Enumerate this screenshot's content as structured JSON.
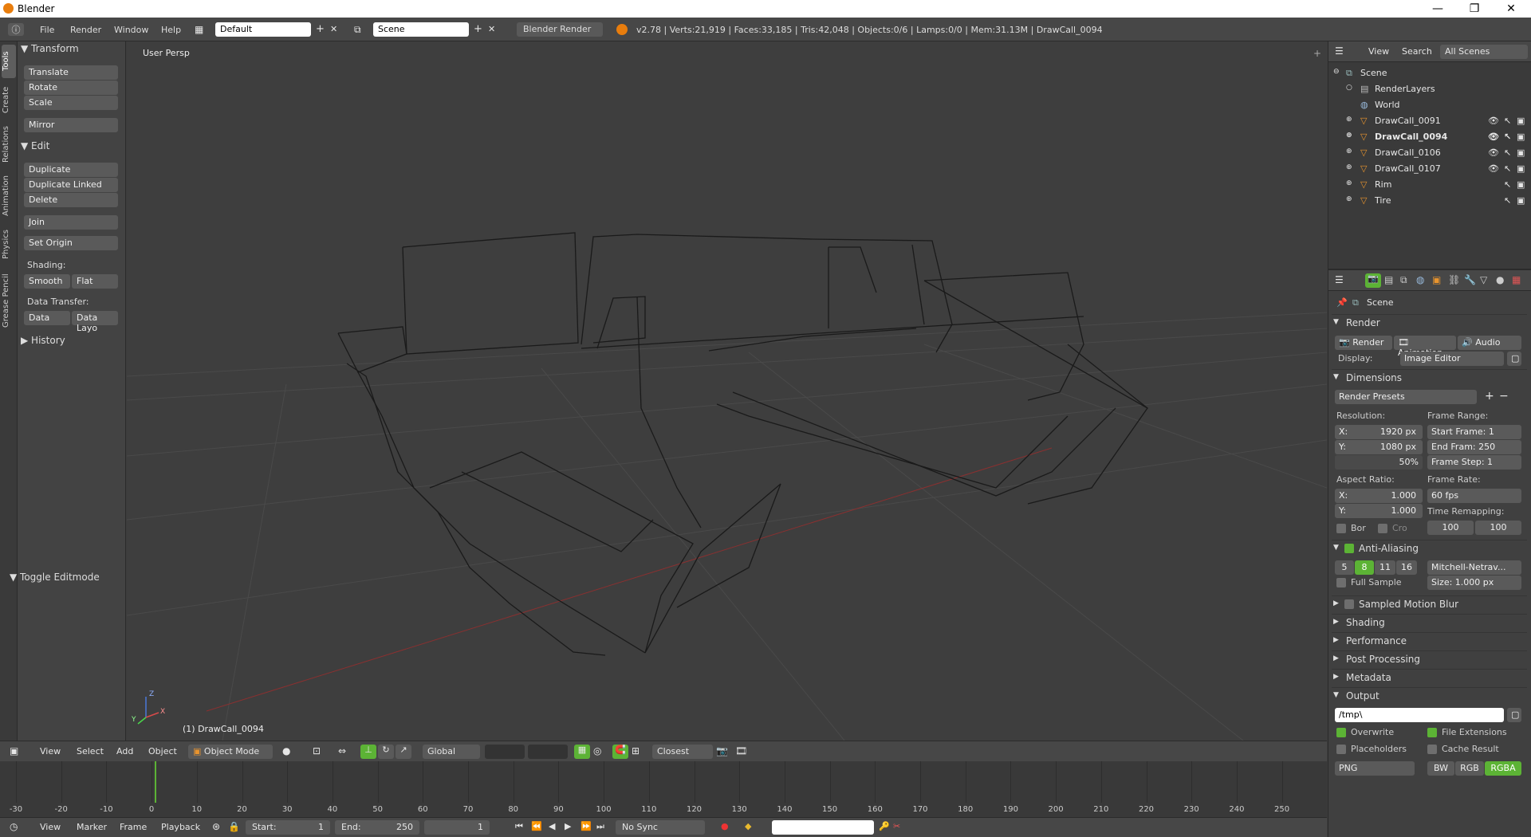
{
  "window": {
    "title": "Blender",
    "minimize": "—",
    "maximize": "❐",
    "close": "✕"
  },
  "topbar": {
    "menus": [
      "File",
      "Render",
      "Window",
      "Help"
    ],
    "screen_layout": "Default",
    "scene": "Scene",
    "engine": "Blender Render",
    "stats": "v2.78 | Verts:21,919 | Faces:33,185 | Tris:42,048 | Objects:0/6 | Lamps:0/0 | Mem:31.13M | DrawCall_0094"
  },
  "toolshelf": {
    "tabs": [
      "Tools",
      "Create",
      "Relations",
      "Animation",
      "Physics",
      "Grease Pencil"
    ],
    "transform_header": "Transform",
    "transform": [
      "Translate",
      "Rotate",
      "Scale"
    ],
    "mirror": "Mirror",
    "edit_header": "Edit",
    "edit": [
      "Duplicate",
      "Duplicate Linked",
      "Delete"
    ],
    "join": "Join",
    "set_origin": "Set Origin",
    "shading_label": "Shading:",
    "smooth": "Smooth",
    "flat": "Flat",
    "data_transfer_label": "Data Transfer:",
    "data": "Data",
    "data_layo": "Data Layo",
    "history_header": "History",
    "toggle_editmode": "Toggle Editmode"
  },
  "viewport": {
    "label": "User Persp",
    "active_object": "(1) DrawCall_0094",
    "axis_x": "X",
    "axis_y": "Y",
    "axis_z": "Z"
  },
  "outliner": {
    "view": "View",
    "search": "Search",
    "filter": "All Scenes",
    "items": [
      {
        "name": "Scene"
      },
      {
        "name": "RenderLayers"
      },
      {
        "name": "World"
      },
      {
        "name": "DrawCall_0091"
      },
      {
        "name": "DrawCall_0094"
      },
      {
        "name": "DrawCall_0106"
      },
      {
        "name": "DrawCall_0107"
      },
      {
        "name": "Rim"
      },
      {
        "name": "Tire"
      }
    ]
  },
  "properties": {
    "context": "Scene",
    "render_header": "Render",
    "render_btn": "Render",
    "animation_btn": "Animation",
    "audio_btn": "Audio",
    "display_label": "Display:",
    "display_value": "Image Editor",
    "dimensions_header": "Dimensions",
    "render_presets": "Render Presets",
    "resolution_label": "Resolution:",
    "res_x": "X:",
    "res_x_value": "1920 px",
    "res_y": "Y:",
    "res_y_value": "1080 px",
    "res_pct": "50%",
    "frame_range_label": "Frame Range:",
    "start_frame": "Start Frame: 1",
    "end_frame": "End Fram: 250",
    "frame_step": "Frame Step: 1",
    "aspect_label": "Aspect Ratio:",
    "asp_x": "X:",
    "asp_x_value": "1.000",
    "asp_y": "Y:",
    "asp_y_value": "1.000",
    "frame_rate_label": "Frame Rate:",
    "frame_rate": "60 fps",
    "bor": "Bor",
    "cro": "Cro",
    "time_remap_label": "Time Remapping:",
    "remap_old": "100",
    "remap_new": "100",
    "aa_header": "Anti-Aliasing",
    "aa_samples": [
      "5",
      "8",
      "11",
      "16"
    ],
    "aa_filter": "Mitchell-Netrav...",
    "full_sample": "Full Sample",
    "aa_size": "Size: 1.000 px",
    "motion_blur": "Sampled Motion Blur",
    "shading": "Shading",
    "performance": "Performance",
    "post_processing": "Post Processing",
    "metadata": "Metadata",
    "output_header": "Output",
    "output_path": "/tmp\\",
    "overwrite": "Overwrite",
    "file_extensions": "File Extensions",
    "placeholders": "Placeholders",
    "cache_result": "Cache Result",
    "format": "PNG",
    "bw": "BW",
    "rgb": "RGB",
    "rgba": "RGBA"
  },
  "view3d_header": {
    "menus": [
      "View",
      "Select",
      "Add",
      "Object"
    ],
    "mode": "Object Mode",
    "orientation": "Global",
    "snap": "Closest"
  },
  "timeline": {
    "ticks": [
      "-30",
      "-20",
      "-10",
      "0",
      "10",
      "20",
      "30",
      "40",
      "50",
      "60",
      "70",
      "80",
      "90",
      "100",
      "110",
      "120",
      "130",
      "140",
      "150",
      "160",
      "170",
      "180",
      "190",
      "200",
      "210",
      "220",
      "230",
      "240",
      "250"
    ],
    "menus": [
      "View",
      "Marker",
      "Frame",
      "Playback"
    ],
    "start_label": "Start:",
    "start_value": "1",
    "end_label": "End:",
    "end_value": "250",
    "current": "1",
    "sync": "No Sync"
  }
}
